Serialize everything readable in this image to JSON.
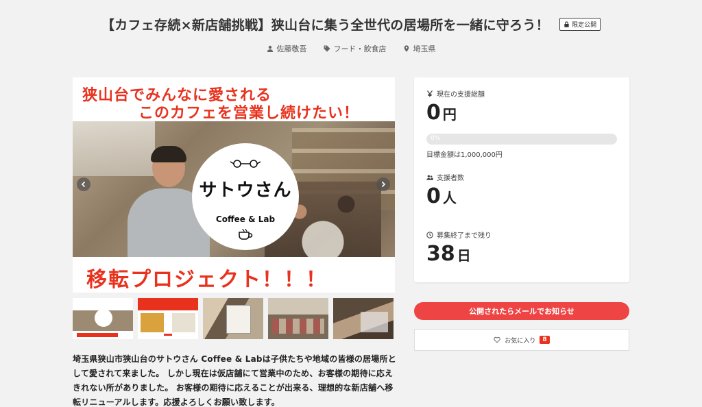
{
  "project": {
    "title": "【カフェ存続×新店舗挑戦】狭山台に集う全世代の居場所を一緒に守ろう！",
    "badge": "限定公開",
    "owner": "佐藤敬吾",
    "category": "フード・飲食店",
    "location": "埼玉県"
  },
  "visual": {
    "line1": "狭山台でみんなに愛される",
    "line2": "このカフェを営業し続けたい！",
    "logo_name": "サトウさん",
    "logo_sub": "Coffee & Lab",
    "bottom": "移転プロジェクト！！！"
  },
  "description": "埼玉県狭山市狭山台のサトウさん Coffee & Labは子供たちや地域の皆様の居場所として愛されて来ました。 しかし現在は仮店舗にて営業中のため、お客様の期待に応えきれない所がありました。 お客様の期待に応えることが出来る、理想的な新店舗へ移転リニューアルします。応援よろしくお願い致します。",
  "stats": {
    "total_label": "現在の支援総額",
    "total_value": "0",
    "total_unit": "円",
    "progress_text": "0%",
    "progress_percent": 0,
    "goal_text": "目標金額は1,000,000円",
    "backers_label": "支援者数",
    "backers_value": "0",
    "backers_unit": "人",
    "remaining_label": "募集終了まで残り",
    "remaining_value": "38",
    "remaining_unit": "日"
  },
  "actions": {
    "notify_label": "公開されたらメールでお知らせ",
    "favorite_label": "お気に入り",
    "favorite_count": "8"
  },
  "colors": {
    "accent": "#ee4444",
    "headline_red": "#e8321e"
  }
}
